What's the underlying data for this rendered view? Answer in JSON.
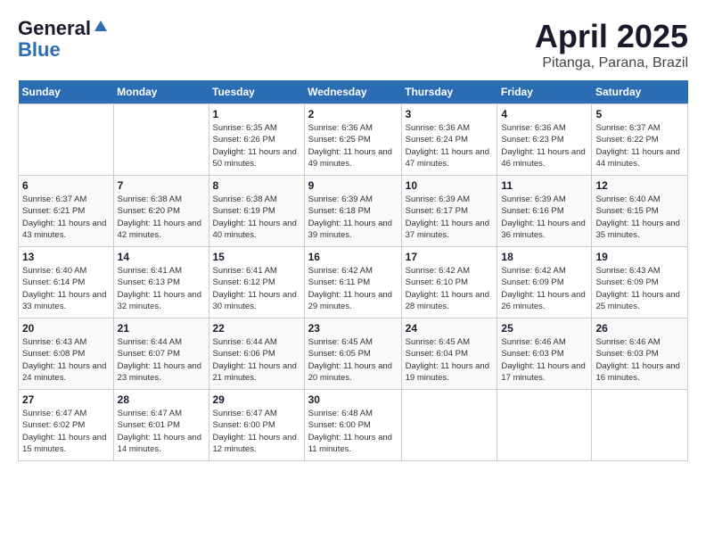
{
  "header": {
    "logo": {
      "general": "General",
      "blue": "Blue"
    },
    "title": "April 2025",
    "location": "Pitanga, Parana, Brazil"
  },
  "calendar": {
    "days_of_week": [
      "Sunday",
      "Monday",
      "Tuesday",
      "Wednesday",
      "Thursday",
      "Friday",
      "Saturday"
    ],
    "weeks": [
      [
        {
          "day": "",
          "sunrise": "",
          "sunset": "",
          "daylight": ""
        },
        {
          "day": "",
          "sunrise": "",
          "sunset": "",
          "daylight": ""
        },
        {
          "day": "1",
          "sunrise": "Sunrise: 6:35 AM",
          "sunset": "Sunset: 6:26 PM",
          "daylight": "Daylight: 11 hours and 50 minutes."
        },
        {
          "day": "2",
          "sunrise": "Sunrise: 6:36 AM",
          "sunset": "Sunset: 6:25 PM",
          "daylight": "Daylight: 11 hours and 49 minutes."
        },
        {
          "day": "3",
          "sunrise": "Sunrise: 6:36 AM",
          "sunset": "Sunset: 6:24 PM",
          "daylight": "Daylight: 11 hours and 47 minutes."
        },
        {
          "day": "4",
          "sunrise": "Sunrise: 6:36 AM",
          "sunset": "Sunset: 6:23 PM",
          "daylight": "Daylight: 11 hours and 46 minutes."
        },
        {
          "day": "5",
          "sunrise": "Sunrise: 6:37 AM",
          "sunset": "Sunset: 6:22 PM",
          "daylight": "Daylight: 11 hours and 44 minutes."
        }
      ],
      [
        {
          "day": "6",
          "sunrise": "Sunrise: 6:37 AM",
          "sunset": "Sunset: 6:21 PM",
          "daylight": "Daylight: 11 hours and 43 minutes."
        },
        {
          "day": "7",
          "sunrise": "Sunrise: 6:38 AM",
          "sunset": "Sunset: 6:20 PM",
          "daylight": "Daylight: 11 hours and 42 minutes."
        },
        {
          "day": "8",
          "sunrise": "Sunrise: 6:38 AM",
          "sunset": "Sunset: 6:19 PM",
          "daylight": "Daylight: 11 hours and 40 minutes."
        },
        {
          "day": "9",
          "sunrise": "Sunrise: 6:39 AM",
          "sunset": "Sunset: 6:18 PM",
          "daylight": "Daylight: 11 hours and 39 minutes."
        },
        {
          "day": "10",
          "sunrise": "Sunrise: 6:39 AM",
          "sunset": "Sunset: 6:17 PM",
          "daylight": "Daylight: 11 hours and 37 minutes."
        },
        {
          "day": "11",
          "sunrise": "Sunrise: 6:39 AM",
          "sunset": "Sunset: 6:16 PM",
          "daylight": "Daylight: 11 hours and 36 minutes."
        },
        {
          "day": "12",
          "sunrise": "Sunrise: 6:40 AM",
          "sunset": "Sunset: 6:15 PM",
          "daylight": "Daylight: 11 hours and 35 minutes."
        }
      ],
      [
        {
          "day": "13",
          "sunrise": "Sunrise: 6:40 AM",
          "sunset": "Sunset: 6:14 PM",
          "daylight": "Daylight: 11 hours and 33 minutes."
        },
        {
          "day": "14",
          "sunrise": "Sunrise: 6:41 AM",
          "sunset": "Sunset: 6:13 PM",
          "daylight": "Daylight: 11 hours and 32 minutes."
        },
        {
          "day": "15",
          "sunrise": "Sunrise: 6:41 AM",
          "sunset": "Sunset: 6:12 PM",
          "daylight": "Daylight: 11 hours and 30 minutes."
        },
        {
          "day": "16",
          "sunrise": "Sunrise: 6:42 AM",
          "sunset": "Sunset: 6:11 PM",
          "daylight": "Daylight: 11 hours and 29 minutes."
        },
        {
          "day": "17",
          "sunrise": "Sunrise: 6:42 AM",
          "sunset": "Sunset: 6:10 PM",
          "daylight": "Daylight: 11 hours and 28 minutes."
        },
        {
          "day": "18",
          "sunrise": "Sunrise: 6:42 AM",
          "sunset": "Sunset: 6:09 PM",
          "daylight": "Daylight: 11 hours and 26 minutes."
        },
        {
          "day": "19",
          "sunrise": "Sunrise: 6:43 AM",
          "sunset": "Sunset: 6:09 PM",
          "daylight": "Daylight: 11 hours and 25 minutes."
        }
      ],
      [
        {
          "day": "20",
          "sunrise": "Sunrise: 6:43 AM",
          "sunset": "Sunset: 6:08 PM",
          "daylight": "Daylight: 11 hours and 24 minutes."
        },
        {
          "day": "21",
          "sunrise": "Sunrise: 6:44 AM",
          "sunset": "Sunset: 6:07 PM",
          "daylight": "Daylight: 11 hours and 23 minutes."
        },
        {
          "day": "22",
          "sunrise": "Sunrise: 6:44 AM",
          "sunset": "Sunset: 6:06 PM",
          "daylight": "Daylight: 11 hours and 21 minutes."
        },
        {
          "day": "23",
          "sunrise": "Sunrise: 6:45 AM",
          "sunset": "Sunset: 6:05 PM",
          "daylight": "Daylight: 11 hours and 20 minutes."
        },
        {
          "day": "24",
          "sunrise": "Sunrise: 6:45 AM",
          "sunset": "Sunset: 6:04 PM",
          "daylight": "Daylight: 11 hours and 19 minutes."
        },
        {
          "day": "25",
          "sunrise": "Sunrise: 6:46 AM",
          "sunset": "Sunset: 6:03 PM",
          "daylight": "Daylight: 11 hours and 17 minutes."
        },
        {
          "day": "26",
          "sunrise": "Sunrise: 6:46 AM",
          "sunset": "Sunset: 6:03 PM",
          "daylight": "Daylight: 11 hours and 16 minutes."
        }
      ],
      [
        {
          "day": "27",
          "sunrise": "Sunrise: 6:47 AM",
          "sunset": "Sunset: 6:02 PM",
          "daylight": "Daylight: 11 hours and 15 minutes."
        },
        {
          "day": "28",
          "sunrise": "Sunrise: 6:47 AM",
          "sunset": "Sunset: 6:01 PM",
          "daylight": "Daylight: 11 hours and 14 minutes."
        },
        {
          "day": "29",
          "sunrise": "Sunrise: 6:47 AM",
          "sunset": "Sunset: 6:00 PM",
          "daylight": "Daylight: 11 hours and 12 minutes."
        },
        {
          "day": "30",
          "sunrise": "Sunrise: 6:48 AM",
          "sunset": "Sunset: 6:00 PM",
          "daylight": "Daylight: 11 hours and 11 minutes."
        },
        {
          "day": "",
          "sunrise": "",
          "sunset": "",
          "daylight": ""
        },
        {
          "day": "",
          "sunrise": "",
          "sunset": "",
          "daylight": ""
        },
        {
          "day": "",
          "sunrise": "",
          "sunset": "",
          "daylight": ""
        }
      ]
    ]
  }
}
